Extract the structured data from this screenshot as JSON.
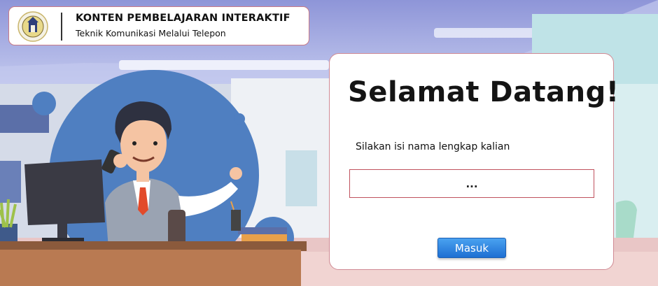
{
  "header": {
    "title": "KONTEN PEMBELAJARAN INTERAKTIF",
    "subtitle": "Teknik Komunikasi Melalui Telepon"
  },
  "login": {
    "welcome": "Selamat Datang!",
    "prompt": "Silakan isi nama lengkap kalian",
    "name_placeholder": "...",
    "button_label": "Masuk"
  },
  "colors": {
    "card_border": "#d08a94",
    "button": "#2f86e0",
    "accent_circle": "#4f7fc1",
    "tie": "#e24a2a"
  }
}
